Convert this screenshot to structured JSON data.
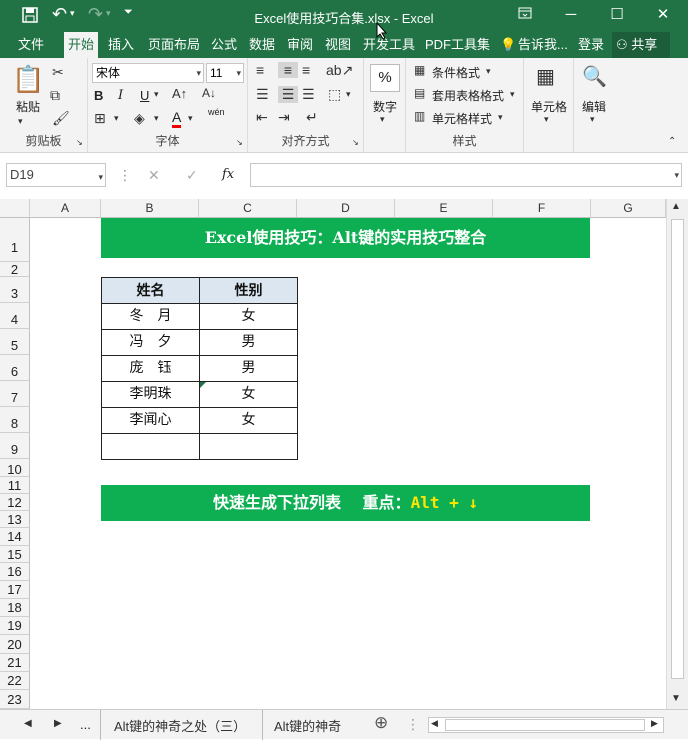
{
  "titlebar": {
    "title": "Excel使用技巧合集.xlsx - Excel",
    "save_icon": "save-icon",
    "undo_icon": "undo-icon",
    "redo_icon": "redo-icon",
    "restore_icon": "ribbon-display-icon",
    "min_glyph": "─",
    "max_glyph": "☐",
    "close_glyph": "✕"
  },
  "tabs": [
    "文件",
    "开始",
    "插入",
    "页面布局",
    "公式",
    "数据",
    "审阅",
    "视图",
    "开发工具",
    "PDF工具集"
  ],
  "tell_me": "告诉我...",
  "login": "登录",
  "share": "共享",
  "ribbon": {
    "clipboard": {
      "paste": "粘贴",
      "label": "剪贴板"
    },
    "font": {
      "name": "宋体",
      "size": "11",
      "bold": "B",
      "italic": "I",
      "underline": "U",
      "label": "字体",
      "font_color_glyph": "A",
      "phonetic": "wén"
    },
    "align": {
      "label": "对齐方式"
    },
    "number": {
      "label": "数字",
      "pct": "%"
    },
    "styles": {
      "cond": "条件格式",
      "table": "套用表格格式",
      "cell": "单元格样式",
      "label": "样式"
    },
    "cells": {
      "label": "单元格"
    },
    "editing": {
      "label": "编辑"
    }
  },
  "formula_bar": {
    "name_box": "D19",
    "fx": "fx",
    "cancel": "✕",
    "enter": "✓",
    "value": ""
  },
  "columns": [
    "A",
    "B",
    "C",
    "D",
    "E",
    "F",
    "G"
  ],
  "rows": [
    "1",
    "2",
    "3",
    "4",
    "5",
    "6",
    "7",
    "8",
    "9",
    "10",
    "11",
    "12",
    "13",
    "14",
    "15",
    "16",
    "17",
    "18",
    "19",
    "20",
    "21",
    "22",
    "23"
  ],
  "banner1": "Excel使用技巧：Alt键的实用技巧整合",
  "table": {
    "headers": [
      "姓名",
      "性别"
    ],
    "rows": [
      [
        "冬　月",
        "女"
      ],
      [
        "冯　夕",
        "男"
      ],
      [
        "庞　钰",
        "男"
      ],
      [
        "李明珠",
        "女"
      ],
      [
        "李闻心",
        "女"
      ],
      [
        "",
        ""
      ]
    ]
  },
  "banner2": {
    "main": "快速生成下拉列表　 重点：",
    "key": "Alt + ↓"
  },
  "sheets": {
    "ellipsis": "...",
    "tab1": "Alt键的神奇之处（三）",
    "tab2": "Alt键的神奇",
    "add": "⊕"
  },
  "colors": {
    "excel_green": "#217346",
    "banner_green": "#0eaf53",
    "header_fill": "#dce6f1",
    "accent_yellow": "#ffe600"
  }
}
